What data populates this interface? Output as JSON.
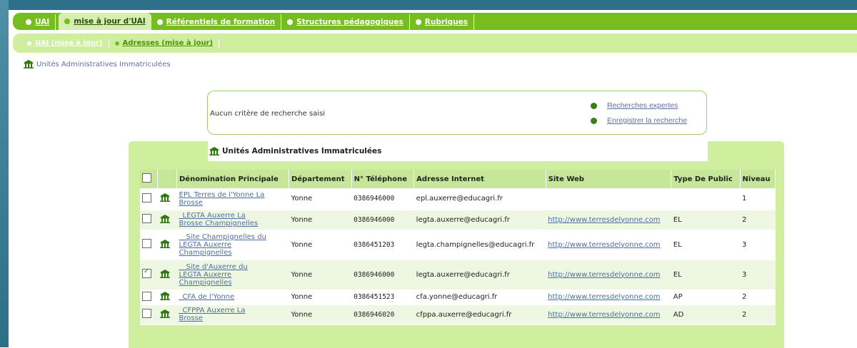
{
  "nav": {
    "tabs": [
      {
        "label": "UAI"
      },
      {
        "label": "mise à jour d'UAI"
      },
      {
        "label": "Référentiels de formation"
      },
      {
        "label": "Structures pédagogiques"
      },
      {
        "label": "Rubriques"
      }
    ],
    "subtabs": [
      {
        "label": "UAI (mise à jour)"
      },
      {
        "label": "Adresses (mise à jour)"
      }
    ]
  },
  "breadcrumb": {
    "label": "Unités Administratives Immatriculées"
  },
  "search": {
    "criteria_text": "Aucun critère de recherche saisi",
    "expert_link": "Recherches expertes",
    "save_link": "Enregistrer la recherche"
  },
  "panel": {
    "title": "Unités Administratives Immatriculées"
  },
  "table": {
    "columns": [
      "Dénomination Principale",
      "Département",
      "N° Téléphone",
      "Adresse Internet",
      "Site Web",
      "Type De Public",
      "Niveau"
    ],
    "rows": [
      {
        "name": "EPL Terres de l'Yonne La Brosse",
        "dept": "Yonne",
        "phone": "0386946000",
        "email": "epl.auxerre@educagri.fr",
        "web": "",
        "public": "",
        "level": "1",
        "checked": false
      },
      {
        "name": "_LEGTA Auxerre La Brosse Champignelles",
        "dept": "Yonne",
        "phone": "0386946000",
        "email": "legta.auxerre@educagri.fr",
        "web": "http://www.terresdelyonne.com",
        "public": "EL",
        "level": "2",
        "checked": false
      },
      {
        "name": "__Site Champignelles du LEGTA Auxerre Champignelles",
        "dept": "Yonne",
        "phone": "0386451203",
        "email": "legta.champignelles@educagri.fr",
        "web": "http://www.terresdelyonne.com",
        "public": "EL",
        "level": "3",
        "checked": false
      },
      {
        "name": "__Site d'Auxerre du LEGTA Auxerre Champignelles",
        "dept": "Yonne",
        "phone": "0386946000",
        "email": "legta.auxerre@educagri.fr",
        "web": "http://www.terresdelyonne.com",
        "public": "EL",
        "level": "3",
        "checked": true
      },
      {
        "name": "_CFA de l'Yonne",
        "dept": "Yonne",
        "phone": "0386451523",
        "email": "cfa.yonne@educagri.fr",
        "web": "http://www.terresdelyonne.com",
        "public": "AP",
        "level": "2",
        "checked": false
      },
      {
        "name": "_CFPPA Auxerre La Brosse",
        "dept": "Yonne",
        "phone": "0386946020",
        "email": "cfppa.auxerre@educagri.fr",
        "web": "http://www.terresdelyonne.com",
        "public": "AD",
        "level": "2",
        "checked": false
      }
    ]
  },
  "colors": {
    "accent": "#76bd1f",
    "light": "#cfee9e",
    "link": "#4e6e9e"
  }
}
